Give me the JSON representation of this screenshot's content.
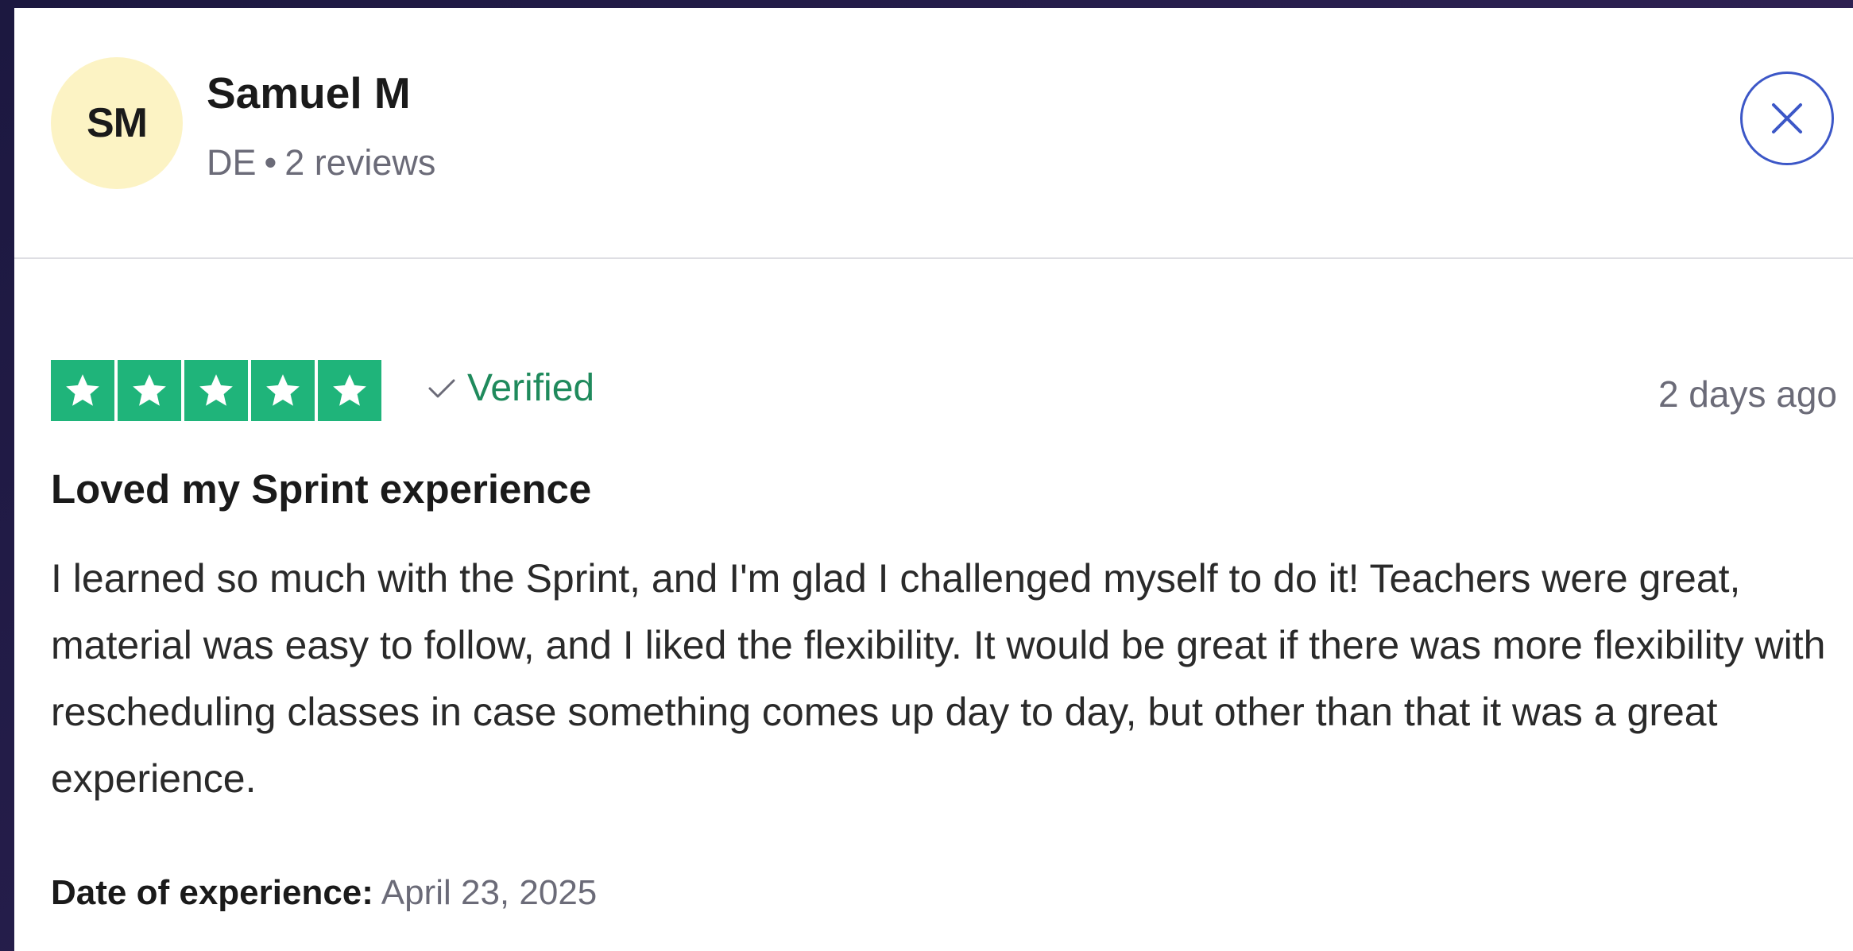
{
  "user": {
    "initials": "SM",
    "name": "Samuel M",
    "country": "DE",
    "separator": "•",
    "reviews": "2 reviews"
  },
  "review": {
    "rating": 5,
    "rating_max": 5,
    "verified_label": "Verified",
    "time_ago": "2 days ago",
    "title": "Loved my Sprint experience",
    "body": "I learned so much with the Sprint, and I'm glad I challenged myself to do it! Teachers were great, material was easy to follow, and I liked the flexibility. It would be great if there was more flexibility with rescheduling classes in case something comes up day to day, but other than that it was a great experience.",
    "date_label": "Date of experience:",
    "date_value": "April 23, 2025"
  },
  "icons": {
    "close": "close-icon",
    "star": "star-icon",
    "check": "checkmark-icon"
  },
  "colors": {
    "star_background": "#1fb47a",
    "verified_text": "#1f8a5c",
    "avatar_background": "#fcf3c4",
    "close_button_border": "#3c57c7"
  }
}
